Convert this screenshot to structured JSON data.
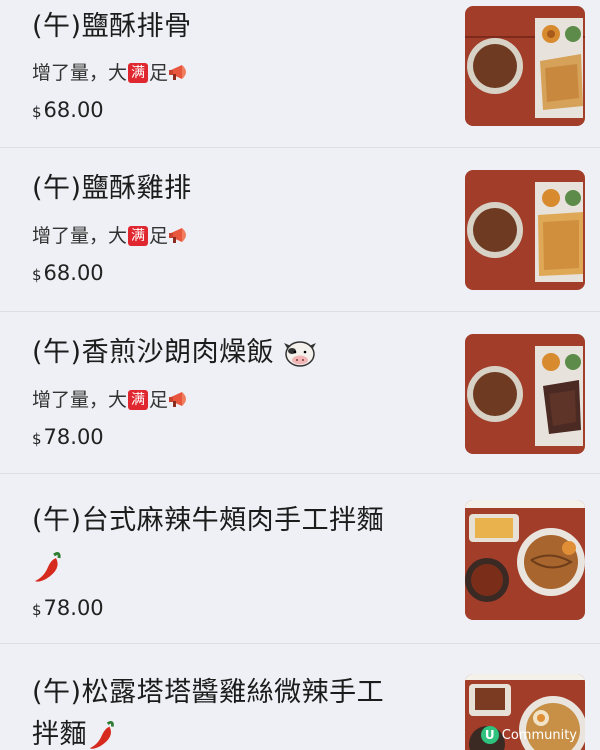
{
  "items": [
    {
      "name": "(午)鹽酥排骨",
      "desc_before": "增了量，大",
      "badge": "满",
      "desc_after": "足",
      "currency": "$",
      "price": "68.00"
    },
    {
      "name": "(午)鹽酥雞排",
      "desc_before": "增了量，大",
      "badge": "满",
      "desc_after": "足",
      "currency": "$",
      "price": "68.00"
    },
    {
      "name": "(午)香煎沙朗肉燥飯",
      "desc_before": "增了量，大",
      "badge": "满",
      "desc_after": "足",
      "currency": "$",
      "price": "78.00"
    },
    {
      "name_line1": "(午)台式麻辣牛頰肉手工拌麵",
      "currency": "$",
      "price": "78.00"
    },
    {
      "name_line1": "(午)松露塔塔醬雞絲微辣手工",
      "name_line2": "拌麵"
    }
  ],
  "watermark": {
    "logo": "U",
    "text": "Community"
  }
}
